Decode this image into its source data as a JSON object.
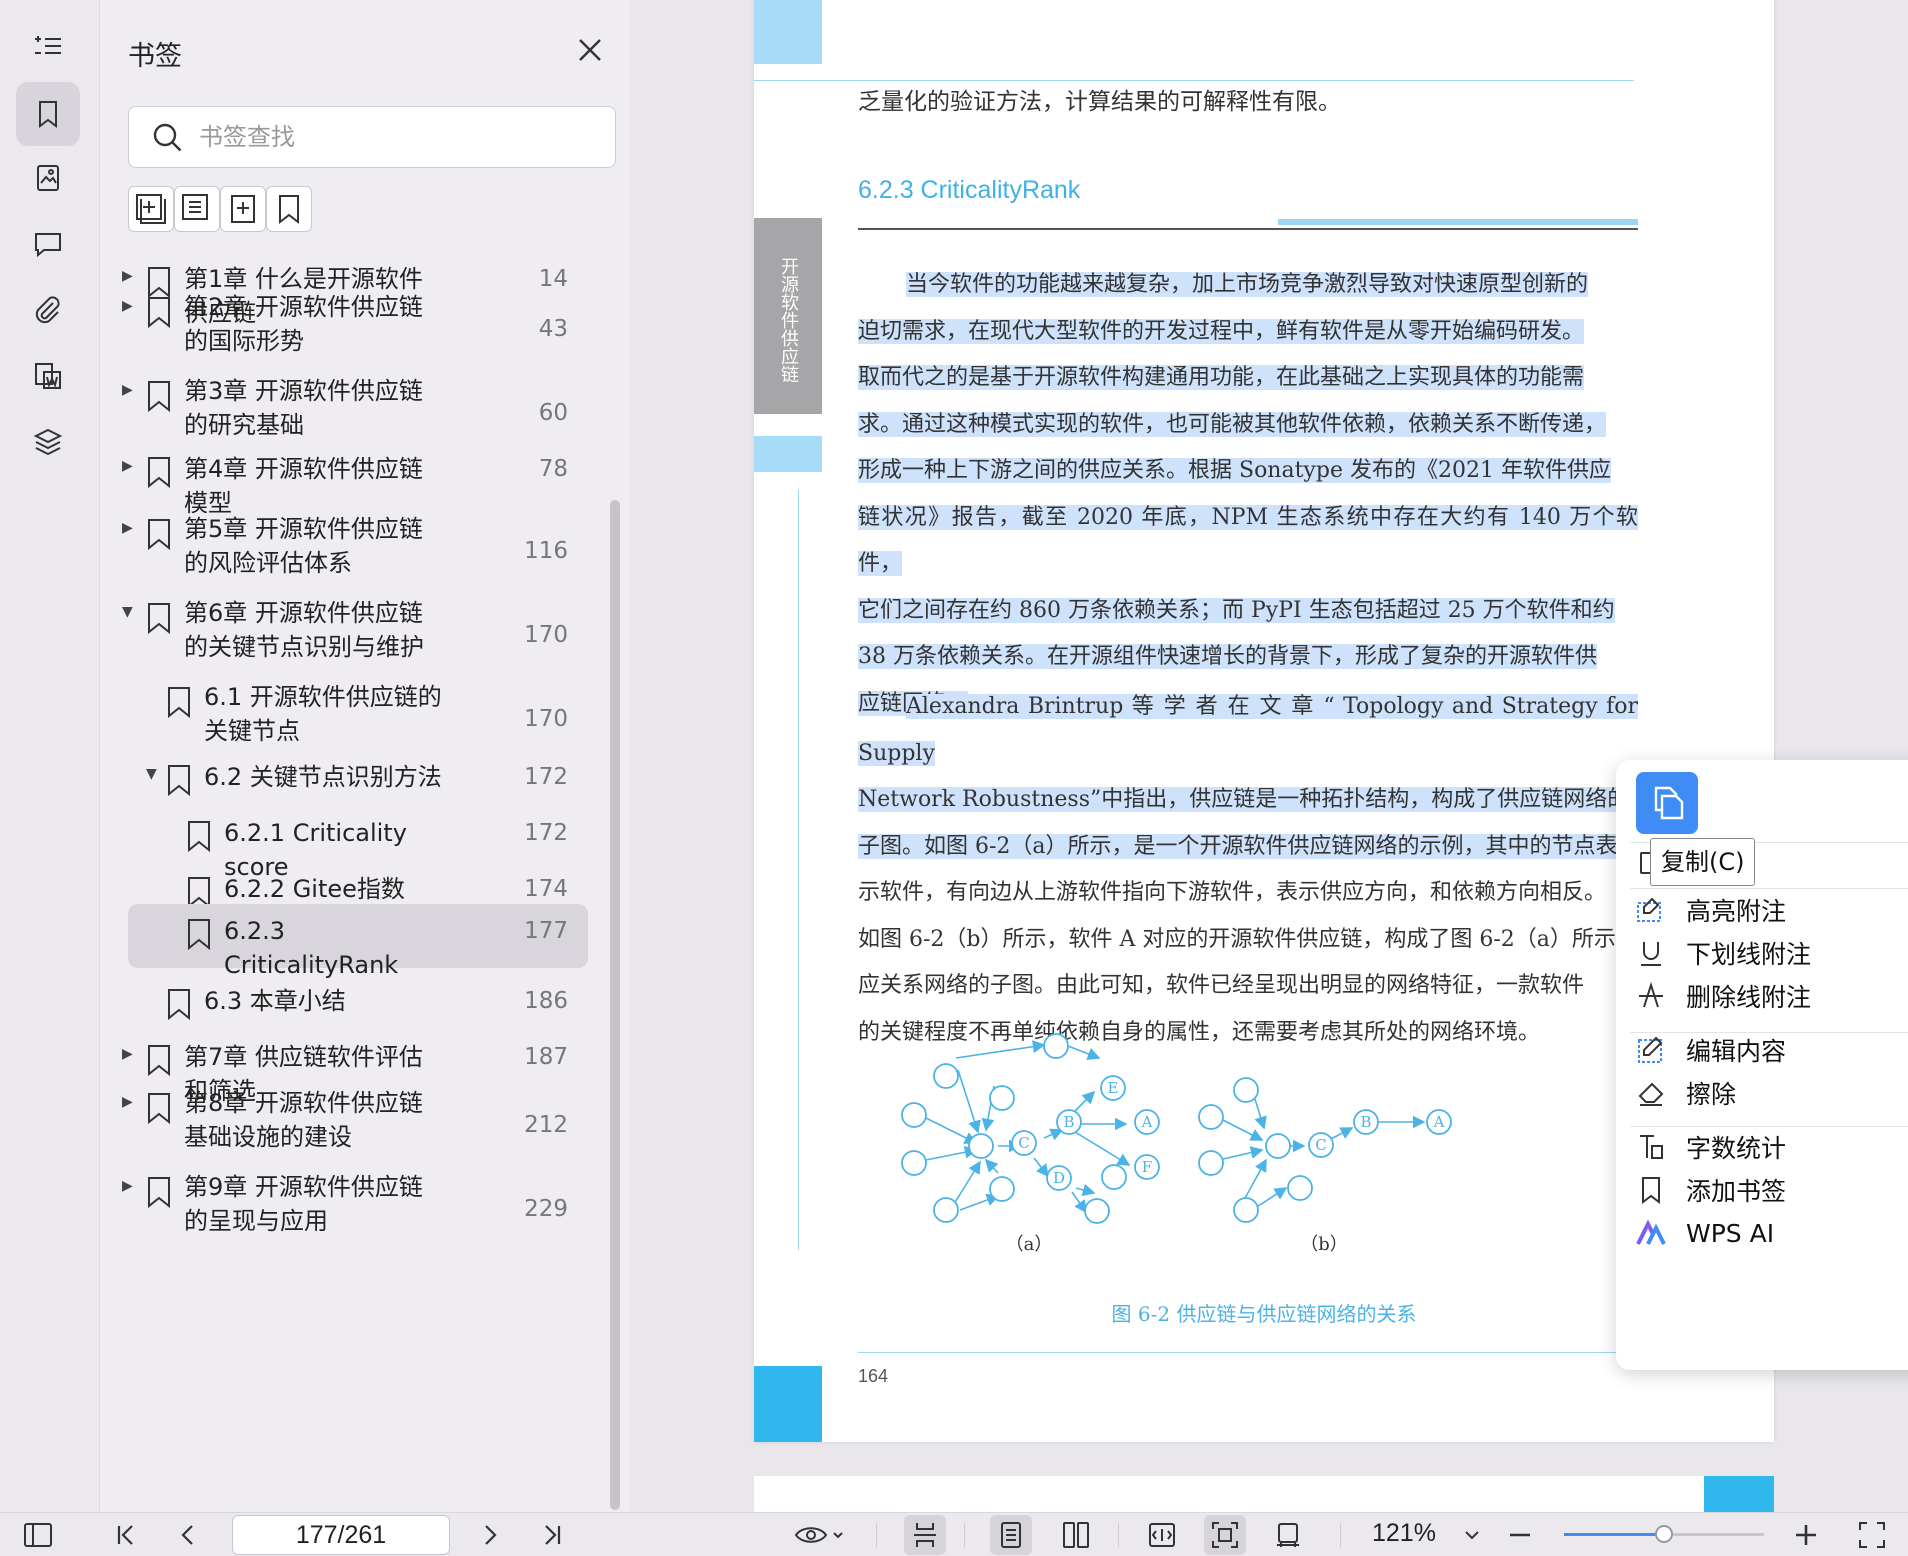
{
  "panel": {
    "title": "书签",
    "search_placeholder": "书签查找"
  },
  "rail": {
    "icons": [
      "outline-icon",
      "bookmark-icon",
      "thumbnail-icon",
      "comment-icon",
      "attachment-icon",
      "signature-icon",
      "layers-icon"
    ]
  },
  "toolbar": {
    "buttons": [
      "add-bookmark-icon",
      "add-child-bookmark-icon",
      "insert-bookmark-icon",
      "bookmark-icon"
    ]
  },
  "bookmarks": [
    {
      "label": "第1章 什么是开源软件供应链",
      "page": "14"
    },
    {
      "label": "第2章 开源软件供应链的国际形势",
      "page": "43"
    },
    {
      "label": "第3章 开源软件供应链的研究基础",
      "page": "60"
    },
    {
      "label": "第4章 开源软件供应链模型",
      "page": "78"
    },
    {
      "label": "第5章 开源软件供应链的风险评估体系",
      "page": "116"
    },
    {
      "label": "第6章 开源软件供应链的关键节点识别与维护",
      "page": "170"
    },
    {
      "label": "6.1 开源软件供应链的关键节点",
      "page": "170"
    },
    {
      "label": "6.2 关键节点识别方法",
      "page": "172"
    },
    {
      "label": "6.2.1 Criticality score",
      "page": "172"
    },
    {
      "label": "6.2.2 Gitee指数",
      "page": "174"
    },
    {
      "label": "6.2.3 CriticalityRank",
      "page": "177"
    },
    {
      "label": "6.3 本章小结",
      "page": "186"
    },
    {
      "label": "第7章 供应链软件评估和筛选",
      "page": "187"
    },
    {
      "label": "第8章 开源软件供应链基础设施的建设",
      "page": "212"
    },
    {
      "label": "第9章 开源软件供应链的呈现与应用",
      "page": "229"
    }
  ],
  "page": {
    "side_tab": "开源软件供应链",
    "carryover": "乏量化的验证方法，计算结果的可解释性有限。",
    "heading": "6.2.3  CriticalityRank",
    "para1_lines": [
      "当今软件的功能越来越复杂，加上市场竞争激烈导致对快速原型创新的",
      "迫切需求，在现代大型软件的开发过程中，鲜有软件是从零开始编码研发。",
      "取而代之的是基于开源软件构建通用功能，在此基础之上实现具体的功能需",
      "求。通过这种模式实现的软件，也可能被其他软件依赖，依赖关系不断传递，",
      "形成一种上下游之间的供应关系。根据 Sonatype 发布的《2021 年软件供应",
      "链状况》报告，截至 2020 年底，NPM 生态系统中存在大约有 140 万个软件，",
      "它们之间存在约 860 万条依赖关系；而 PyPI 生态包括超过 25 万个软件和约",
      "38 万条依赖关系。在开源组件快速增长的背景下，形成了复杂的开源软件供",
      "应链网络。"
    ],
    "para2_lines_hl": [
      "Alexandra Brintrup 等 学 者 在 文 章 “ Topology and Strategy for Supply",
      "Network Robustness”中指出，供应链是一种拓扑结构，构成了供应链网络的",
      "子图。如图 6-2（a）所示，是一个开源软件供应链网络的示例，其中的节点表"
    ],
    "para2_lines": [
      "示软件，有向边从上游软件指向下游软件，表示供应方向，和依赖方向相反。",
      "如图 6-2（b）所示，软件 A 对应的开源软件供应链，构成了图 6-2（a）所示供",
      "应关系网络的子图。由此可知，软件已经呈现出明显的网络特征，一款软件",
      "的关键程度不再单纯依赖自身的属性，还需要考虑其所处的网络环境。"
    ],
    "fig_label_a": "（a）",
    "fig_label_b": "（b）",
    "fig_caption": "图 6-2    供应链与供应链网络的关系",
    "fig_nodes": {
      "a": "A",
      "b": "B",
      "c": "C",
      "d": "D",
      "e": "E",
      "f": "F"
    },
    "page_number": "164"
  },
  "context_menu": {
    "copy_tooltip": "复制(C)",
    "tooltip_tail": ")",
    "items": [
      {
        "label": "高亮附注",
        "icon": "highlight-icon",
        "shortcut": "⇧"
      },
      {
        "label": "下划线附注",
        "icon": "underline-icon",
        "shortcut": "⇧"
      },
      {
        "label": "删除线附注",
        "icon": "strikethrough-icon",
        "shortcut": ""
      },
      {
        "label": "编辑内容",
        "icon": "edit-icon",
        "shortcut": ""
      },
      {
        "label": "擦除",
        "icon": "eraser-icon",
        "shortcut": ""
      },
      {
        "label": "字数统计",
        "icon": "word-count-icon",
        "shortcut": ""
      },
      {
        "label": "添加书签",
        "icon": "bookmark-icon",
        "shortcut": ""
      },
      {
        "label": "WPS AI",
        "icon": "wps-ai-icon",
        "shortcut": ""
      }
    ]
  },
  "statusbar": {
    "page_value": "177/261",
    "zoom": "121%",
    "zoom_level": 0.5
  },
  "colors": {
    "accent": "#3f8cf6",
    "heading_blue": "#3fb1e6",
    "highlight": "#cfe2fb",
    "page_accent": "#2fb7ee"
  }
}
